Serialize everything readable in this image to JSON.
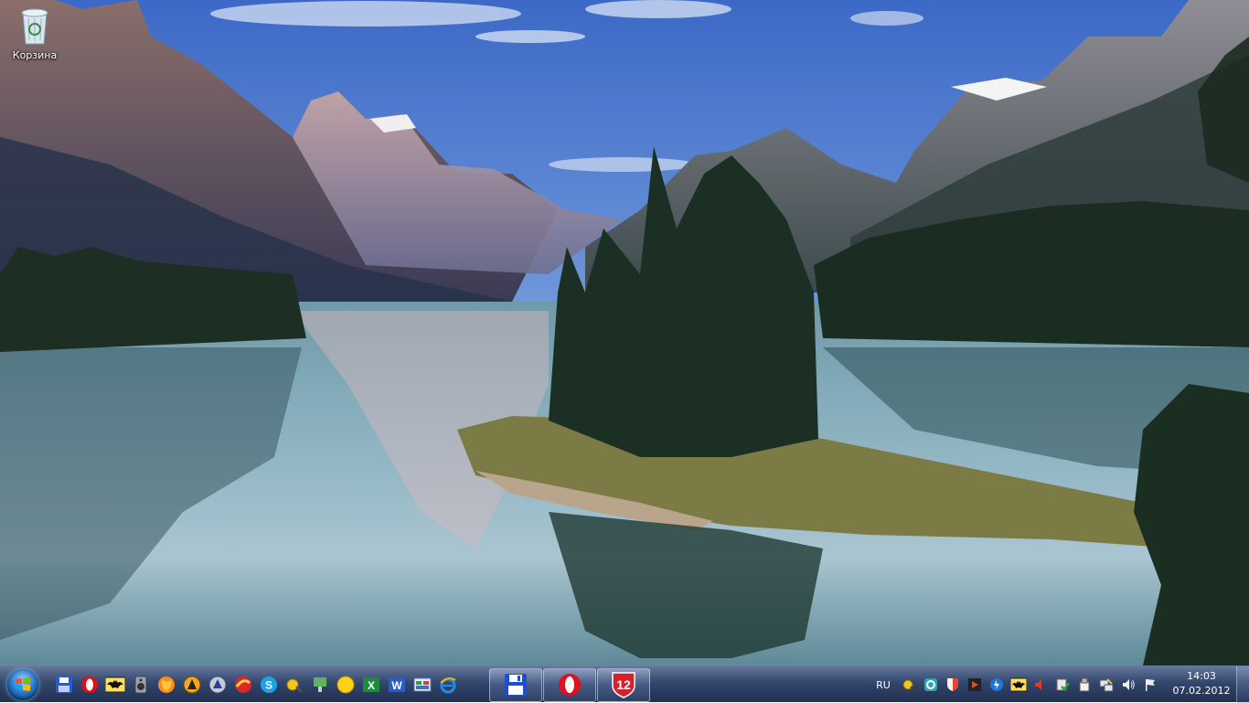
{
  "desktop": {
    "icons": [
      {
        "label": "Корзина",
        "icon": "recycle-bin-icon"
      }
    ]
  },
  "taskbar": {
    "quicklaunch": [
      "save-icon",
      "opera-icon",
      "batman-icon",
      "speaker-app-icon",
      "firefox-icon",
      "vlc-icon",
      "app-icon",
      "browser-icon",
      "skype-icon",
      "qip-icon",
      "network-icon",
      "smiley-icon",
      "excel-icon",
      "word-icon",
      "control-panel-icon",
      "ie-icon"
    ],
    "tasks": [
      {
        "icon": "floppy-icon"
      },
      {
        "icon": "opera-icon"
      },
      {
        "label": "12",
        "icon": "shield-12-icon"
      }
    ],
    "tray": {
      "language": "RU",
      "icons": [
        "qip-tray-icon",
        "sync-icon",
        "shield-tray-icon",
        "media-icon",
        "update-icon",
        "batman-tray-icon",
        "volume-mute-icon",
        "security-icon",
        "usb-icon",
        "network-tray-icon",
        "volume-icon",
        "flag-icon"
      ]
    },
    "clock": {
      "time": "14:03",
      "date": "07.02.2012"
    }
  }
}
